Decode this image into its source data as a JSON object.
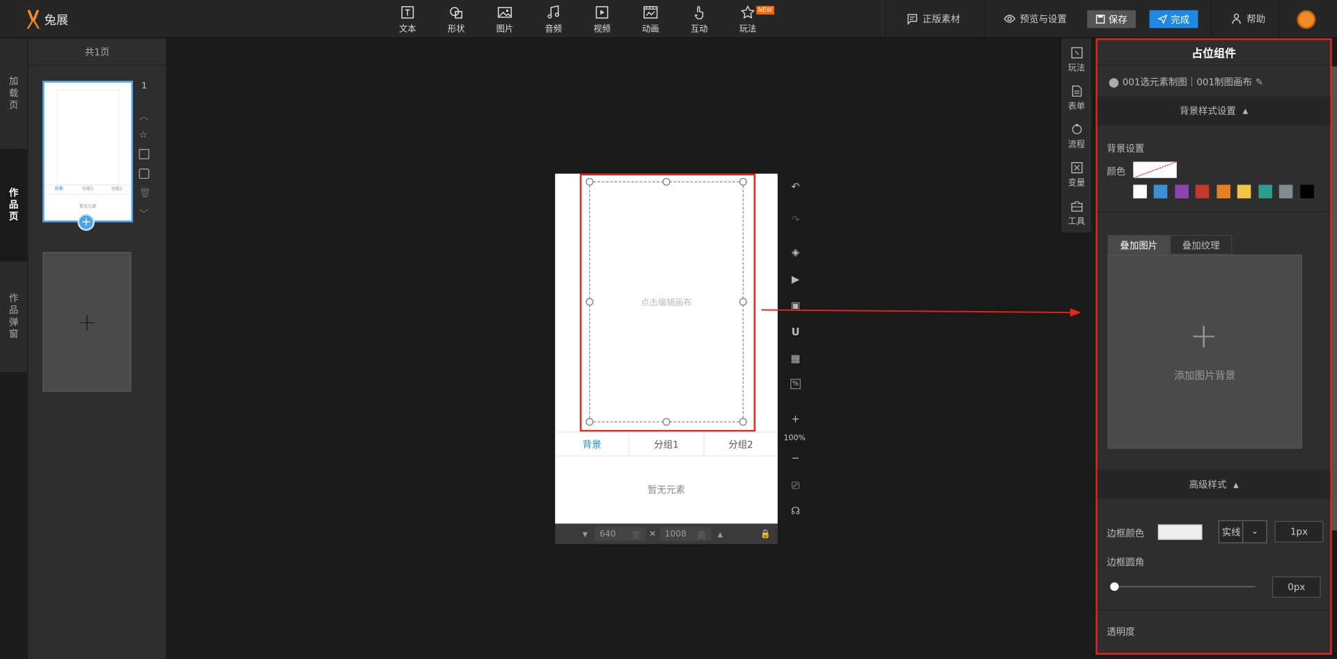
{
  "app": {
    "name": "兔展"
  },
  "toolbar": {
    "tools": [
      {
        "label": "文本",
        "icon": "text-icon"
      },
      {
        "label": "形状",
        "icon": "shape-icon"
      },
      {
        "label": "图片",
        "icon": "image-icon"
      },
      {
        "label": "音频",
        "icon": "music-icon"
      },
      {
        "label": "视频",
        "icon": "video-icon"
      },
      {
        "label": "动画",
        "icon": "animation-icon"
      },
      {
        "label": "互动",
        "icon": "hand-icon"
      },
      {
        "label": "玩法",
        "icon": "star-icon"
      }
    ],
    "new_badge": "NEW",
    "licensed_assets": "正版素材",
    "preview_settings": "预览与设置",
    "save": "保存",
    "done": "完成",
    "help": "帮助"
  },
  "left_tabs": [
    {
      "label": "加载页",
      "active": false
    },
    {
      "label": "作品页",
      "active": true
    },
    {
      "label": "作品弹窗",
      "active": false
    }
  ],
  "pages_panel": {
    "header": "共1页",
    "page_number": "1",
    "thumb_tabs": [
      "背景",
      "分组1",
      "分组2"
    ],
    "thumb_empty": "暂无元素"
  },
  "canvas": {
    "placeholder_text": "点击编辑画布",
    "tabs": [
      {
        "label": "背景",
        "active": true
      },
      {
        "label": "分组1",
        "active": false
      },
      {
        "label": "分组2",
        "active": false
      }
    ],
    "empty_text": "暂无元素",
    "width": "640",
    "width_unit": "宽",
    "height": "1008",
    "height_unit": "高",
    "zoom": "100%"
  },
  "right_toolbar": [
    {
      "label": "玩法",
      "icon": "game-icon"
    },
    {
      "label": "表单",
      "icon": "form-icon"
    },
    {
      "label": "流程",
      "icon": "flow-icon"
    },
    {
      "label": "变量",
      "icon": "variable-icon"
    },
    {
      "label": "工具",
      "icon": "toolbox-icon"
    }
  ],
  "panel": {
    "title": "占位组件",
    "path": "001选元素制图｜001制图画布",
    "bg_section": "背景样式设置",
    "bg_settings": "背景设置",
    "color_label": "颜色",
    "swatches": [
      "#ffffff",
      "#3a8fd6",
      "#8e44ad",
      "#c0392b",
      "#e67e22",
      "#f4c542",
      "#2a9d8f",
      "#7f8c8d",
      "#000000"
    ],
    "overlay_tabs": [
      {
        "label": "叠加图片",
        "active": true
      },
      {
        "label": "叠加纹理",
        "active": false
      }
    ],
    "add_bg_image": "添加图片背景",
    "advanced_section": "高级样式",
    "border_color_label": "边框颜色",
    "border_style": "实线",
    "border_width": "1px",
    "border_radius_label": "边框圆角",
    "border_radius": "0px",
    "border_radius_level": 0,
    "opacity_label": "透明度"
  }
}
